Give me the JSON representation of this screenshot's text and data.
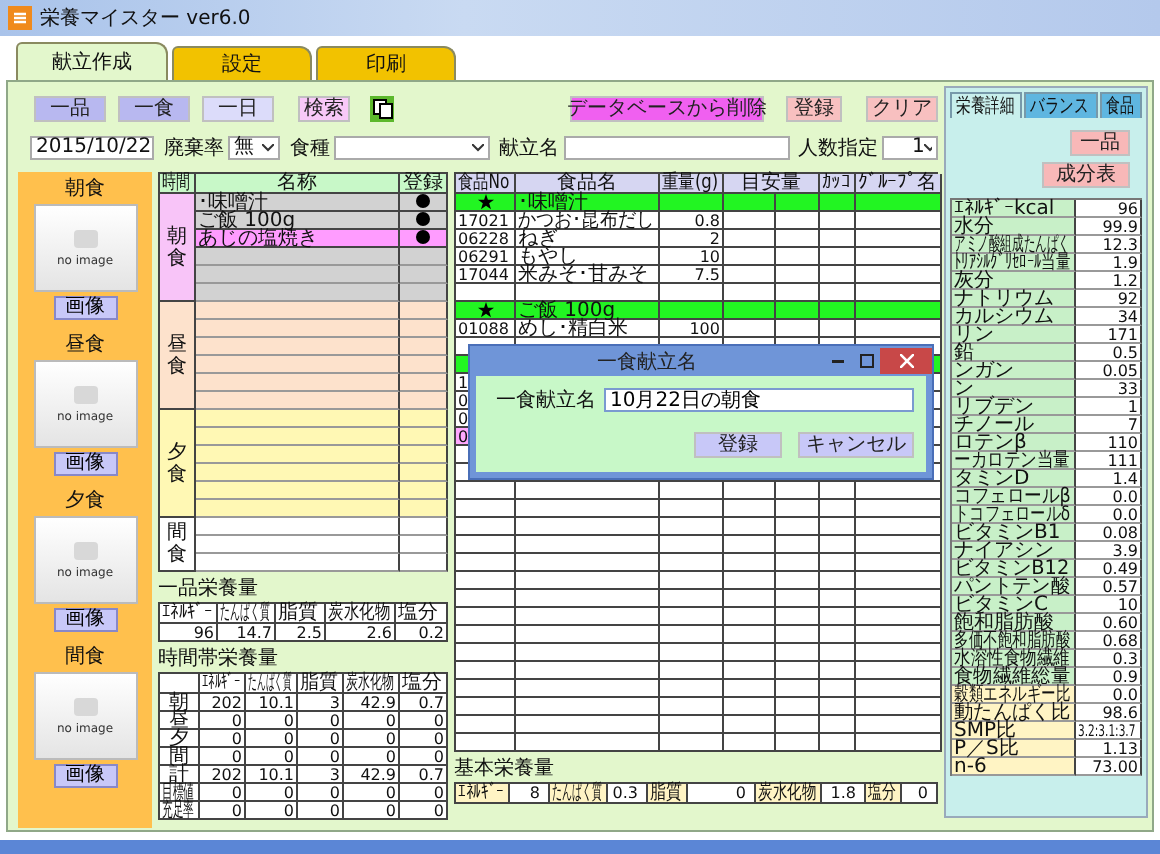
{
  "window": {
    "title": "栄養マイスター ver6.0"
  },
  "tabs": [
    {
      "label": "献立作成",
      "selected": true
    },
    {
      "label": "設定",
      "selected": false
    },
    {
      "label": "印刷",
      "selected": false
    }
  ],
  "modes": [
    {
      "label": "一品",
      "selected": false
    },
    {
      "label": "一食",
      "selected": false
    },
    {
      "label": "一日",
      "selected": true
    }
  ],
  "actions": [
    {
      "kind": "search",
      "label": "検索"
    },
    {
      "kind": "copy"
    },
    {
      "kind": "delete",
      "label": "データベースから削除"
    },
    {
      "kind": "save",
      "label": "登録"
    },
    {
      "kind": "clear",
      "label": "クリア"
    }
  ],
  "filters": {
    "date": "2015/10/22",
    "waste_label": "廃棄率",
    "waste": "無",
    "food_type_label": "食種",
    "menu_name_label": "献立名",
    "people_label": "人数指定",
    "people": "1"
  },
  "photo_slots": [
    {
      "title": "朝食",
      "placeholder": "no image",
      "button": "画像"
    },
    {
      "title": "昼食",
      "placeholder": "no image",
      "button": "画像"
    },
    {
      "title": "夕食",
      "placeholder": "no image",
      "button": "画像"
    },
    {
      "title": "間食",
      "placeholder": "no image",
      "button": "画像"
    }
  ],
  "meal_table": {
    "columns": [
      "時間",
      "名称",
      "登録"
    ],
    "groups": [
      {
        "time": "朝食",
        "kind": "main",
        "color": "#f8c4f8",
        "active": true,
        "items": [
          {
            "name": "･味噌汁",
            "registered": true,
            "selected": false
          },
          {
            "name": "ご飯 100g",
            "registered": true,
            "selected": false
          },
          {
            "name": "あじの塩焼き",
            "registered": true,
            "selected": true
          }
        ]
      },
      {
        "time": "昼食",
        "kind": "main",
        "color": "#fde2cc",
        "active": false
      },
      {
        "time": "夕食",
        "kind": "main",
        "color": "#fff8b4",
        "active": false
      },
      {
        "time": "間食",
        "kind": "snack",
        "color": "#ffffff",
        "active": false
      }
    ]
  },
  "item_nutrition": {
    "title": "一品栄養量",
    "columns": [
      "ｴﾈﾙｷﾞｰ",
      "たんぱく質",
      "脂質",
      "炭水化物",
      "塩分"
    ],
    "values": [
      "96",
      "14.7",
      "2.5",
      "2.6",
      "0.2"
    ]
  },
  "time_nutrition": {
    "title": "時間帯栄養量",
    "columns": [
      "ｴﾈﾙｷﾞｰ",
      "たんぱく質",
      "脂質",
      "炭水化物",
      "塩分"
    ],
    "rows": [
      {
        "label": "朝",
        "values": [
          "202",
          "10.1",
          "3",
          "42.9",
          "0.7"
        ]
      },
      {
        "label": "昼",
        "values": [
          "0",
          "0",
          "0",
          "0",
          "0"
        ]
      },
      {
        "label": "夕",
        "values": [
          "0",
          "0",
          "0",
          "0",
          "0"
        ]
      },
      {
        "label": "間",
        "values": [
          "0",
          "0",
          "0",
          "0",
          "0"
        ]
      },
      {
        "label": "計",
        "values": [
          "202",
          "10.1",
          "3",
          "42.9",
          "0.7"
        ]
      },
      {
        "label": "目標値",
        "values": [
          "0",
          "0",
          "0",
          "0",
          "0"
        ]
      },
      {
        "label": "充足率",
        "values": [
          "0",
          "0",
          "0",
          "0",
          "0"
        ]
      }
    ]
  },
  "food_table": {
    "columns": [
      "食品No",
      "食品名",
      "重量(g)",
      "目安量",
      "ｶｯｺ",
      "ｸﾞﾙｰﾌﾟ名"
    ],
    "rows": [
      {
        "kind": "dish",
        "name": "･味噌汁",
        "selected": false
      },
      {
        "kind": "food",
        "no": "17021",
        "name": "かつお･昆布だし",
        "weight": "0.8",
        "selected": false
      },
      {
        "kind": "food",
        "no": "06228",
        "name": "ねぎ",
        "weight": "2",
        "selected": false
      },
      {
        "kind": "food",
        "no": "06291",
        "name": "もやし",
        "weight": "10",
        "selected": false
      },
      {
        "kind": "food",
        "no": "17044",
        "name": "米みそ･甘みそ",
        "weight": "7.5",
        "selected": false
      },
      {
        "kind": "blank",
        "selected": false
      },
      {
        "kind": "dish",
        "name": "ご飯 100g",
        "selected": false
      },
      {
        "kind": "food",
        "no": "01088",
        "name": "めし･精白米",
        "weight": "100",
        "selected": false
      },
      {
        "kind": "blank",
        "selected": false
      },
      {
        "kind": "dish",
        "selected": false
      },
      {
        "kind": "food",
        "no": "1",
        "selected": false
      },
      {
        "kind": "food",
        "no": "0",
        "selected": false
      },
      {
        "kind": "food",
        "no": "0",
        "selected": false
      },
      {
        "kind": "food",
        "no": "0",
        "selected": true
      }
    ]
  },
  "basic_nutrition": {
    "title": "基本栄養量",
    "items": [
      {
        "label": "ｴﾈﾙｷﾞｰ",
        "value": "8"
      },
      {
        "label": "たんぱく質",
        "value": "0.3"
      },
      {
        "label": "脂質",
        "value": "0"
      },
      {
        "label": "炭水化物",
        "value": "1.8"
      },
      {
        "label": "塩分",
        "value": "0"
      }
    ]
  },
  "detail_panel": {
    "tabs": [
      {
        "label": "栄養詳細",
        "selected": true
      },
      {
        "label": "バランス",
        "selected": false
      },
      {
        "label": "食品",
        "selected": false
      }
    ],
    "buttons": [
      "一品",
      "成分表"
    ],
    "rows": [
      {
        "label": "ｴﾈﾙｷﾞｰkcal",
        "value": "96",
        "kind": "nutrient"
      },
      {
        "label": "水分",
        "value": "99.9",
        "kind": "nutrient"
      },
      {
        "label": "アミノ酸組成たんぱく",
        "value": "12.3",
        "kind": "nutrient"
      },
      {
        "label": "ﾄﾘｱｼﾙｸﾞﾘｾﾛｰﾙ当量",
        "value": "1.9",
        "kind": "nutrient"
      },
      {
        "label": "灰分",
        "value": "1.2",
        "kind": "nutrient"
      },
      {
        "label": "ナトリウム",
        "value": "92",
        "kind": "nutrient"
      },
      {
        "label": "カルシウム",
        "value": "34",
        "kind": "nutrient"
      },
      {
        "label": "リン",
        "value": "171",
        "kind": "nutrient"
      },
      {
        "label": "鉛",
        "value": "0.5",
        "kind": "nutrient"
      },
      {
        "label": "ンガン",
        "value": "0.05",
        "kind": "nutrient"
      },
      {
        "label": "ン",
        "value": "33",
        "kind": "nutrient"
      },
      {
        "label": "リブデン",
        "value": "1",
        "kind": "nutrient"
      },
      {
        "label": "チノール",
        "value": "7",
        "kind": "nutrient"
      },
      {
        "label": "ロテンβ",
        "value": "110",
        "kind": "nutrient"
      },
      {
        "label": "ーカロテン当量",
        "value": "111",
        "kind": "nutrient"
      },
      {
        "label": "タミンD",
        "value": "1.4",
        "kind": "nutrient"
      },
      {
        "label": "コフェロールβ",
        "value": "0.0",
        "kind": "nutrient"
      },
      {
        "label": "トコフェロールδ",
        "value": "0.0",
        "kind": "nutrient"
      },
      {
        "label": "ビタミンB1",
        "value": "0.08",
        "kind": "nutrient"
      },
      {
        "label": "ナイアシン",
        "value": "3.9",
        "kind": "nutrient"
      },
      {
        "label": "ビタミンB12",
        "value": "0.49",
        "kind": "nutrient"
      },
      {
        "label": "パントテン酸",
        "value": "0.57",
        "kind": "nutrient"
      },
      {
        "label": "ビタミンC",
        "value": "10",
        "kind": "nutrient"
      },
      {
        "label": "飽和脂肪酸",
        "value": "0.60",
        "kind": "nutrient"
      },
      {
        "label": "多価不飽和脂肪酸",
        "value": "0.68",
        "kind": "nutrient"
      },
      {
        "label": "水溶性食物繊維",
        "value": "0.3",
        "kind": "nutrient"
      },
      {
        "label": "食物繊維総量",
        "value": "0.9",
        "kind": "nutrient"
      },
      {
        "label": "穀類エネルギー比",
        "value": "0.0",
        "kind": "ratio"
      },
      {
        "label": "動たんぱく比",
        "value": "98.6",
        "kind": "ratio"
      },
      {
        "label": "SMP比",
        "value": "3.2:3.1:3.7",
        "kind": "ratio"
      },
      {
        "label": "P／S比",
        "value": "1.13",
        "kind": "ratio"
      },
      {
        "label": "n-6",
        "value": "73.00",
        "kind": "ratio"
      }
    ]
  },
  "dialog": {
    "title": "一食献立名",
    "label": "一食献立名",
    "value": "10月22日の朝食",
    "buttons": [
      "登録",
      "キャンセル"
    ]
  }
}
